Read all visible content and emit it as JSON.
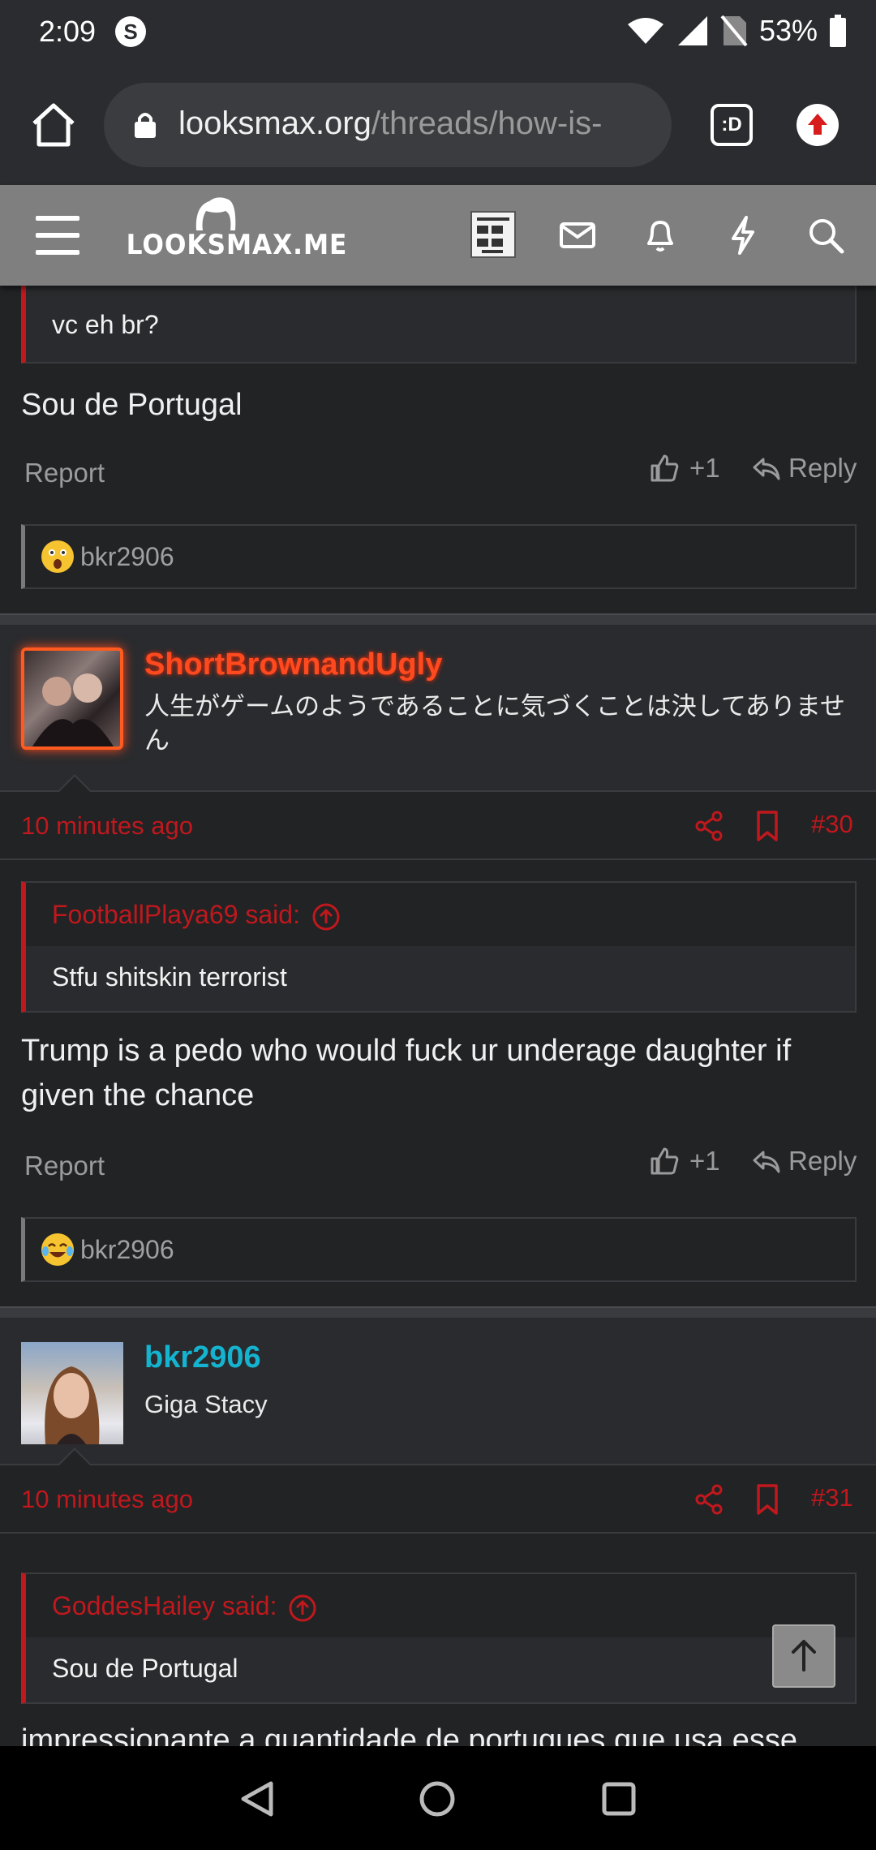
{
  "status_bar": {
    "time": "2:09",
    "battery": "53%"
  },
  "browser": {
    "url_host": "looksmax.org",
    "url_path": "/threads/how-is-",
    "ext_label": ":D"
  },
  "site": {
    "logo_text": "LOOKSMAX.ME"
  },
  "post_prev": {
    "quote_text": "vc eh br?",
    "message": "Sou de Portugal",
    "report_label": "Report",
    "like_count": "+1",
    "reply_label": "Reply",
    "reaction_user": "bkr2906"
  },
  "post_30": {
    "username": "ShortBrownandUgly",
    "user_title": "人生がゲームのようであることに気づくことは決してありません",
    "time": "10 minutes ago",
    "post_number": "#30",
    "quote_author": "FootballPlaya69 said:",
    "quote_text": "Stfu shitskin terrorist",
    "message": "Trump is a pedo who would fuck ur underage daughter if given the chance",
    "report_label": "Report",
    "like_count": "+1",
    "reply_label": "Reply",
    "reaction_user": "bkr2906"
  },
  "post_31": {
    "username": "bkr2906",
    "user_title": "Giga Stacy",
    "time": "10 minutes ago",
    "post_number": "#31",
    "quote_author": "GoddesHailey said:",
    "quote_text": "Sou de Portugal",
    "message": "impressionante a quantidade de portugues que usa esse"
  },
  "colors": {
    "accent_red": "#c0181d",
    "username_orange": "#ff4a1f",
    "username_cyan": "#14b4d0"
  }
}
